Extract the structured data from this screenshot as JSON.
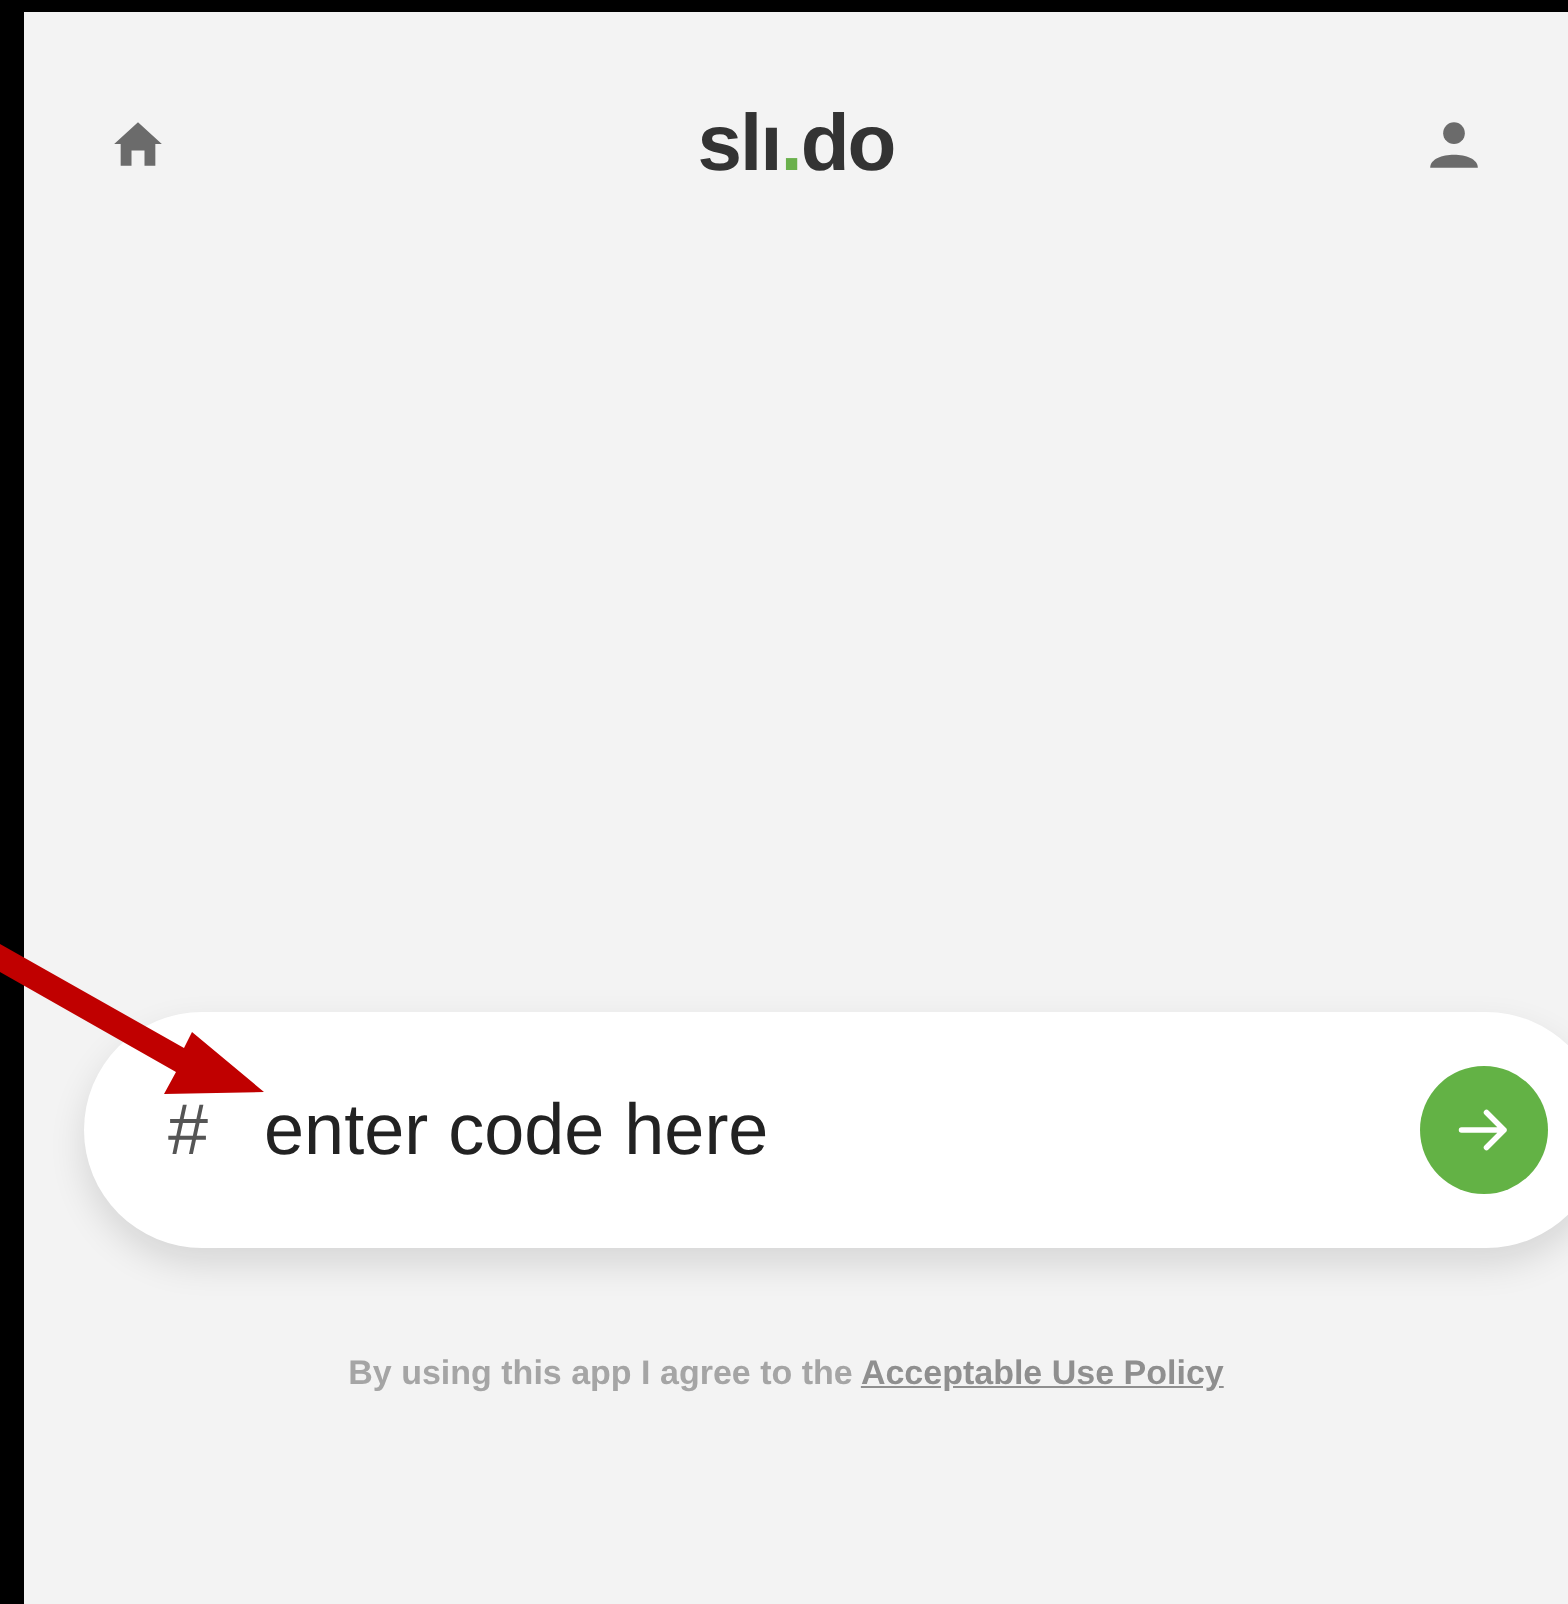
{
  "header": {
    "logo": [
      {
        "text": "slı"
      },
      {
        "text": ".",
        "color": "#6ab04c"
      },
      {
        "text": "do"
      }
    ]
  },
  "code_field": {
    "prefix": "#",
    "placeholder": "enter code here"
  },
  "footer": {
    "text": "By using this app I agree to the",
    "link": "Acceptable Use Policy"
  }
}
